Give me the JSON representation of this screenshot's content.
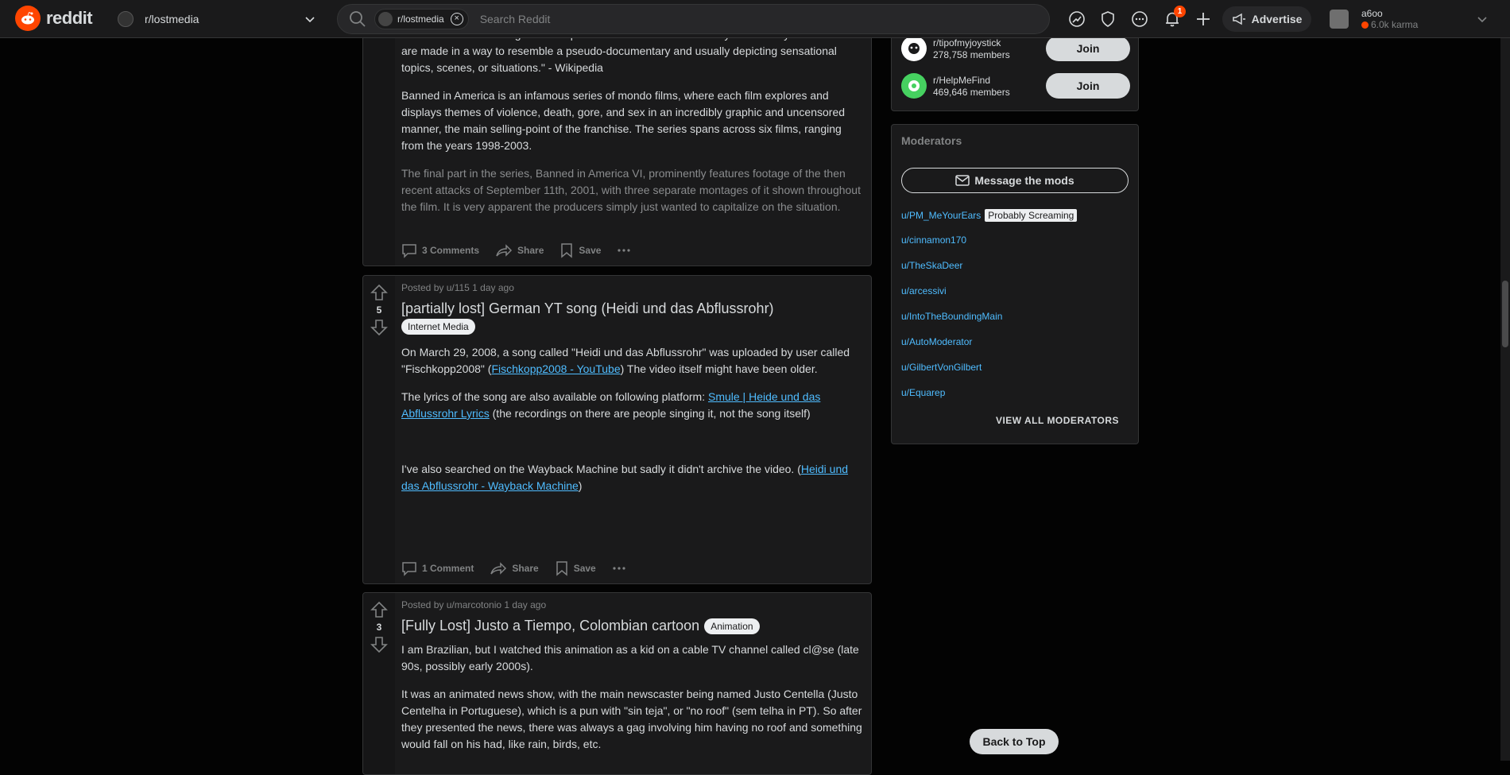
{
  "header": {
    "logo_text": "reddit",
    "community": "r/lostmedia",
    "search_chip": "r/lostmedia",
    "search_placeholder": "Search Reddit",
    "notification_count": "1",
    "advertise_label": "Advertise",
    "username": "a6oo",
    "karma": "6.0k karma"
  },
  "posts": [
    {
      "body_top": "\"Mondo films are a subgenre of exploitation films and documentary films. Many mondo films are made in a way to resemble a pseudo-documentary and usually depicting sensational topics, scenes, or situations.\" - Wikipedia",
      "p1": "Banned in America is an infamous series of mondo films, where each film explores and displays themes of violence, death, gore, and sex in an incredibly graphic and uncensored manner, the main selling-point of the franchise. The series spans across six films, ranging from the years 1998-2003.",
      "p2": "The final part in the series, Banned in America VI, prominently features footage of the then recent attacks of September 11th, 2001, with three separate montages of it shown throughout the film. It is very apparent the producers simply just wanted to capitalize on the situation.",
      "comments": "3 Comments",
      "share": "Share",
      "save": "Save"
    },
    {
      "votes": "5",
      "meta": "Posted by u/115 1 day ago",
      "title": "[partially lost] German YT song (Heidi und das Abflussrohr)",
      "flair": "Internet Media",
      "p1_a": "On March 29, 2008, a song called \"Heidi und das Abflussrohr\" was uploaded by user called \"Fischkopp2008\" (",
      "p1_link": "Fischkopp2008 - YouTube",
      "p1_b": ") The video itself might have been older.",
      "p2_a": "The lyrics of the song are also available on following platform: ",
      "p2_link": "Smule | Heide und das Abflussrohr Lyrics",
      "p2_b": " (the recordings on there are people singing it, not the song itself)",
      "p3_a": "I've also searched on the Wayback Machine but sadly it didn't archive the video. (",
      "p3_link": "Heidi und das Abflussrohr - Wayback Machine",
      "p3_b": ")",
      "comments": "1 Comment",
      "share": "Share",
      "save": "Save"
    },
    {
      "votes": "3",
      "meta": "Posted by u/marcotonio 1 day ago",
      "title": "[Fully Lost] Justo a Tiempo, Colombian cartoon",
      "flair": "Animation",
      "p1": "I am Brazilian, but I watched this animation as a kid on a cable TV channel called cl@se (late 90s, possibly early 2000s).",
      "p2": "It was an animated news show, with the main newscaster being named Justo Centella (Justo Centelha in Portuguese), which is a pun with \"sin teja\", or \"no roof\" (sem telha in PT). So after they presented the news, there was always a gag involving him having no roof and something would fall on his had, like rain, birds, etc."
    }
  ],
  "sidebar": {
    "communities": [
      {
        "name": "r/tipofmyjoystick",
        "members": "278,758 members",
        "join": "Join"
      },
      {
        "name": "r/HelpMeFind",
        "members": "469,646 members",
        "join": "Join"
      }
    ],
    "moderators_title": "Moderators",
    "message_mods": "Message the mods",
    "mods": [
      "u/PM_MeYourEars",
      "u/cinnamon170",
      "u/TheSkaDeer",
      "u/arcessivi",
      "u/IntoTheBoundingMain",
      "u/AutoModerator",
      "u/GilbertVonGilbert",
      "u/Equarep"
    ],
    "first_mod_flair": "Probably Screaming",
    "view_all": "VIEW ALL MODERATORS"
  },
  "back_to_top": "Back to Top",
  "colors": {
    "accent": "#ff4500",
    "link": "#4fbcff",
    "bg": "#030303",
    "card": "#1a1a1b"
  }
}
